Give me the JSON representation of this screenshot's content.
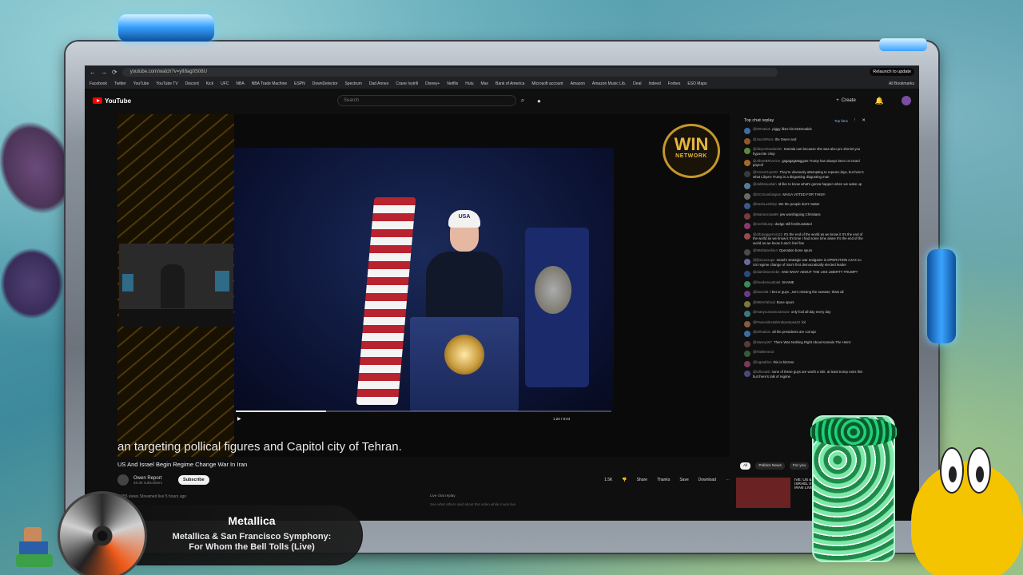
{
  "browser": {
    "url": "youtube.com/watch?v=yII8ag0S08U",
    "relaunch_label": "Relaunch to update",
    "bookmarks": [
      "Facebook",
      "Twitter",
      "YouTube",
      "YouTube TV",
      "Discord",
      "Kick",
      "UFC",
      "NBA",
      "NBA Trade Machine",
      "ESPN",
      "DownDetector",
      "Spectrum",
      "Dad Annex",
      "Crane Ivytrill",
      "Disney+",
      "Netflix",
      "Hulu",
      "Max",
      "Bank of America",
      "Microsoft account",
      "Amazon",
      "Amazon Music Lib.",
      "Deal",
      "Indeed",
      "Forbes",
      "ESO Maps"
    ],
    "all_bookmarks": "All Bookmarks"
  },
  "youtube": {
    "logo_text": "YouTube",
    "search_placeholder": "Search",
    "create_label": "Create"
  },
  "video": {
    "caption": "an targeting pollical figures and Capitol city of Tehran.",
    "cap_text": "USA",
    "overlay_logo_line1": "WIN",
    "overlay_logo_line2": "NETWORK",
    "time": "1:26 / 8:04",
    "progress": 0.24,
    "title": "US And Israel Begin Regime Change War In Iran",
    "channel_name": "Owen Report",
    "channel_subs": "46.3K subscribers",
    "subscribe_label": "Subscribe",
    "actions": {
      "like": "1.5K",
      "share": "Share",
      "thanks": "Thanks",
      "save": "Save",
      "download": "Download"
    },
    "description": "4,355 views  Streamed live 5 hours ago"
  },
  "chat": {
    "header": "Top chat replay",
    "top_fan_label": "Top fans",
    "messages": [
      {
        "author": "@DRnation",
        "text": "piggy likes his McDonalds",
        "color": "#3a6ea5"
      },
      {
        "author": "@JacobRoss",
        "text": "the Owen and",
        "color": "#8e5a2b"
      },
      {
        "author": "@dleyeshowlander",
        "text": "Kamala can because she was also pro Zionist you hypocrite clmp",
        "color": "#5a8a3a"
      },
      {
        "author": "@AlbertBRiverine",
        "text": "gagagagMaggots Trump has always been on Israel payroll",
        "color": "#a56a2a"
      },
      {
        "author": "@GreenGuy262",
        "text": "They're obviously attempting to repeat Libya, but here's what Libya's Trump is a disgusting disgusting man",
        "color": "#3a3a3a"
      },
      {
        "author": "@dobbsauslain",
        "text": "Id like to know what's gonna happen when we wake up",
        "color": "#5a7a9a"
      },
      {
        "author": "@DCGrumbington",
        "text": "MAGA VOTED FOR THIS!!!",
        "color": "#6a6a6a"
      },
      {
        "author": "@trashLambley",
        "text": "We the people don't matter",
        "color": "#3a5a8a"
      },
      {
        "author": "@MarseUsaw99",
        "text": "jew worshipping Christians",
        "color": "#7a3a3a"
      },
      {
        "author": "@nenfsbump",
        "text": "dodge still ferdtrundated",
        "color": "#8a3a6a"
      },
      {
        "author": "@drbrpaggers4122",
        "text": "It's the end of the world as we know it It's the end of the world as we know it It's time I had some time alone It's the end of the world as we know it and I feel fine",
        "color": "#9a4a4a"
      },
      {
        "author": "@90sblazerkie4",
        "text": "Operation bone spurs",
        "color": "#4a4a4a"
      },
      {
        "author": "@fjhexacoupe",
        "text": "Israel's strategic war endgame is OPERATION AJAX so US regime change of Iran's first democratically elected leader",
        "color": "#6a6a9a"
      },
      {
        "author": "@diamlimeeriebe",
        "text": "AND WHAT ABOUT THE USS LIBERTY TRUMP?",
        "color": "#2a4a7a"
      },
      {
        "author": "@freedomouttotal",
        "text": "SHAME",
        "color": "#3a8a5a"
      },
      {
        "author": "@lance66",
        "text": "I bet ur guys ,,Ive's missing the sweater, thats all",
        "color": "#6a3a8a"
      },
      {
        "author": "@800Arfafood",
        "text": "Bone spurs",
        "color": "#7a7a3a"
      },
      {
        "author": "@manyoursamuramuse",
        "text": "only fool all day every day",
        "color": "#3a7a7a"
      },
      {
        "author": "@Pameridectabirrakasmpaa22",
        "text": "lol",
        "color": "#8a5a3a"
      },
      {
        "author": "@DRnation",
        "text": "all the presidents are corrupt",
        "color": "#3a6ea5"
      },
      {
        "author": "@stacey187",
        "text": "There Was Nothing Right About Kamala The Heinz",
        "color": "#5a3a3a"
      },
      {
        "author": "@Raleleneo3",
        "text": "",
        "color": "#3a5a3a"
      },
      {
        "author": "@ingraddon",
        "text": "this is bizzare",
        "color": "#7a3a5a"
      },
      {
        "author": "@toficeanit",
        "text": "none of these guys are worth a shit. at least trump ruins this but there's talk of regime",
        "color": "#4a4a7a"
      }
    ],
    "tabs": [
      "All",
      "Politics News",
      "For you"
    ],
    "related_title": "IVE: US & ISRAEL STRIKE IRAN",
    "related_badge": "LIVE",
    "live_replay": "Live chat replay",
    "live_replay_sub": "See what others said about this video while it was live."
  },
  "now_playing": {
    "artist": "Metallica",
    "song_line1": "Metallica & San Francisco Symphony:",
    "song_line2": "For Whom the Bell Tolls (Live)"
  }
}
